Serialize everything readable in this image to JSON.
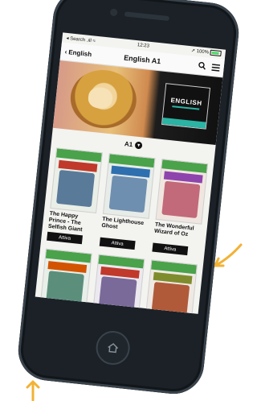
{
  "colors": {
    "annotation_arrow": "#f2b235",
    "accent": "#2bb3a3",
    "device": "#1b2127"
  },
  "status_bar": {
    "carrier": "◂ Search .ıll ≈",
    "time": "12:23",
    "battery_text": "➚ 100%"
  },
  "nav": {
    "back_label": "English",
    "title": "English A1"
  },
  "banner": {
    "brand": "ENGLISH"
  },
  "level": {
    "selected": "A1"
  },
  "books": [
    {
      "title": "The Happy Prince - The Selfish Giant",
      "button": "Attiva",
      "art_color": "#5a7a9a"
    },
    {
      "title": "The Lighthouse Ghost",
      "button": "Attiva",
      "art_color": "#6f8fb0"
    },
    {
      "title": "The Wonderful Wizard of Oz",
      "button": "Attiva",
      "art_color": "#c26a7a"
    },
    {
      "title": "",
      "button": "",
      "art_color": "#5b8f7c"
    },
    {
      "title": "",
      "button": "",
      "art_color": "#7a6a9a"
    },
    {
      "title": "",
      "button": "",
      "art_color": "#b05a3a"
    }
  ]
}
